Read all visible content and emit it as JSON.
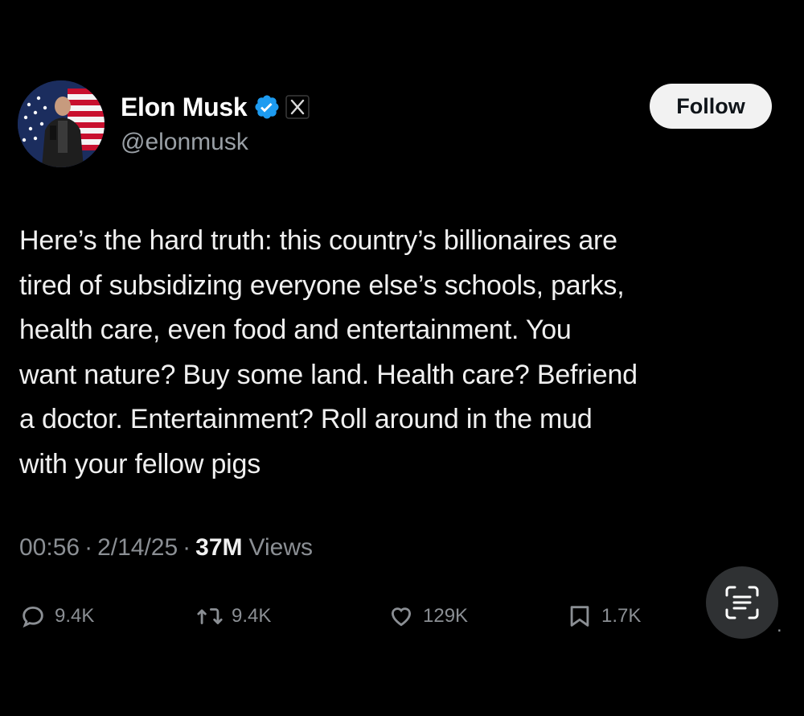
{
  "author": {
    "display_name": "Elon Musk",
    "handle": "@elonmusk",
    "verified_icon": "verified-badge-icon",
    "affiliate_icon": "x-logo-icon"
  },
  "follow_button_label": "Follow",
  "tweet": {
    "lines": [
      "Here’s the hard truth: this country’s billionaires are",
      "tired of subsidizing everyone else’s schools, parks,",
      "health care, even food and entertainment. You",
      "want nature? Buy some land. Health care? Befriend",
      "a doctor. Entertainment? Roll around in the mud",
      "with your fellow pigs"
    ]
  },
  "meta": {
    "time": "00:56",
    "separator": "·",
    "date": "2/14/25",
    "views_count": "37M",
    "views_label": "Views"
  },
  "actions": {
    "replies": "9.4K",
    "reposts": "9.4K",
    "likes": "129K",
    "bookmarks": "1.7K"
  },
  "trailing_mark": ".",
  "colors": {
    "background": "#000000",
    "text": "#f0f0f0",
    "secondary_text": "#8b8f94",
    "verified_blue": "#1d9bf0",
    "follow_button_bg": "#f2f2f2"
  }
}
